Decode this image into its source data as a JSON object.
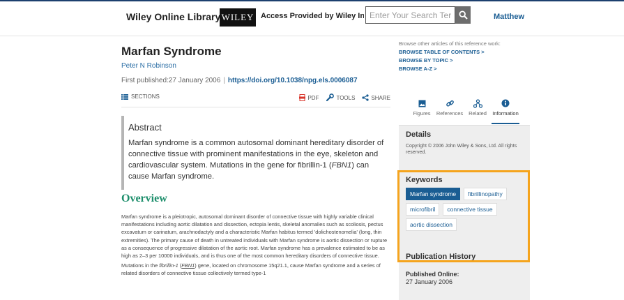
{
  "header": {
    "brand": "Wiley Online Library",
    "logo_text": "WILEY",
    "access": "Access Provided by Wiley Institut",
    "search_placeholder": "Enter Your Search Term",
    "user": "Matthew"
  },
  "article": {
    "title": "Marfan Syndrome",
    "author": "Peter N Robinson",
    "published": "First published:27 January 2006",
    "separator": "|",
    "doi": "https://doi.org/10.1038/npg.els.0006087",
    "toolbar": {
      "sections": "SECTIONS",
      "pdf": "PDF",
      "tools": "TOOLS",
      "share": "SHARE"
    },
    "abstract": {
      "heading": "Abstract",
      "text_before": "Marfan syndrome is a common autosomal dominant hereditary disorder of connective tissue with prominent manifestations in the eye, skeleton and cardiovascular system. Mutations in the gene for fibrillin-1 (",
      "gene": "FBN1",
      "text_after": ") can cause Marfan syndrome."
    },
    "overview_heading": "Overview",
    "overview_p1": "Marfan syndrome is a pleiotropic, autosomal dominant disorder of connective tissue with highly variable clinical manifestations including aortic dilatation and dissection, ectopia lentis, skeletal anomalies such as scoliosis, pectus excavatum or carinatum, arachnodactyly and a characteristic Marfan habitus termed 'dolichostenomelia' (long, thin extremities). The primary cause of death in untreated individuals with Marfan syndrome is aortic dissection or rupture as a consequence of progressive dilatation of the aortic root. Marfan syndrome has a prevalence estimated to be as high as 2–3 per 10000 individuals, and is thus one of the most common hereditary disorders of connective tissue.",
    "overview_p2_a": "Mutations in the ",
    "overview_p2_gene_name": "fibrillin-1",
    "overview_p2_b": " (",
    "overview_p2_gene": "FBN1",
    "overview_p2_c": ") gene, located on chromosome 15q21.1, cause Marfan syndrome and a series of related disorders of connective tissue collectively termed type-1"
  },
  "sidebar": {
    "browse_note": "Browse other articles of this reference work:",
    "links": [
      "BROWSE TABLE OF CONTENTS >",
      "BROWSE BY TOPIC >",
      "BROWSE A-Z >"
    ],
    "tabs": [
      "Figures",
      "References",
      "Related",
      "Information"
    ],
    "details_heading": "Details",
    "copyright": "Copyright © 2006 John Wiley & Sons, Ltd. All rights reserved.",
    "keywords_heading": "Keywords",
    "keywords": [
      "Marfan syndrome",
      "fibrillinopathy",
      "microfibril",
      "connective tissue",
      "aortic dissection"
    ],
    "pubhistory_heading": "Publication History",
    "published_online_label": "Published Online:",
    "published_online_value": "27 January 2006"
  },
  "colors": {
    "brand_blue": "#1a5d93",
    "overview_green": "#1c8e6b",
    "highlight_orange": "#f5a41d",
    "pdf_red": "#d9342b"
  }
}
